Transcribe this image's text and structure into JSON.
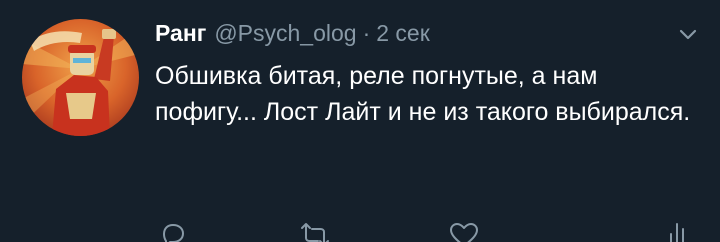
{
  "tweet": {
    "author_name": "Ранг",
    "handle": "@Psych_olog",
    "separator": "·",
    "timestamp": "2 сек",
    "text": "Обшивка битая, реле погнутые, а нам пофигу... Лост Лайт и не из такого выбирался."
  },
  "actions": {
    "icons": [
      "reply-icon",
      "retweet-icon",
      "like-icon",
      "analytics-icon"
    ]
  },
  "colors": {
    "background": "#15202b",
    "text_primary": "#ffffff",
    "text_secondary": "#8899a6"
  }
}
